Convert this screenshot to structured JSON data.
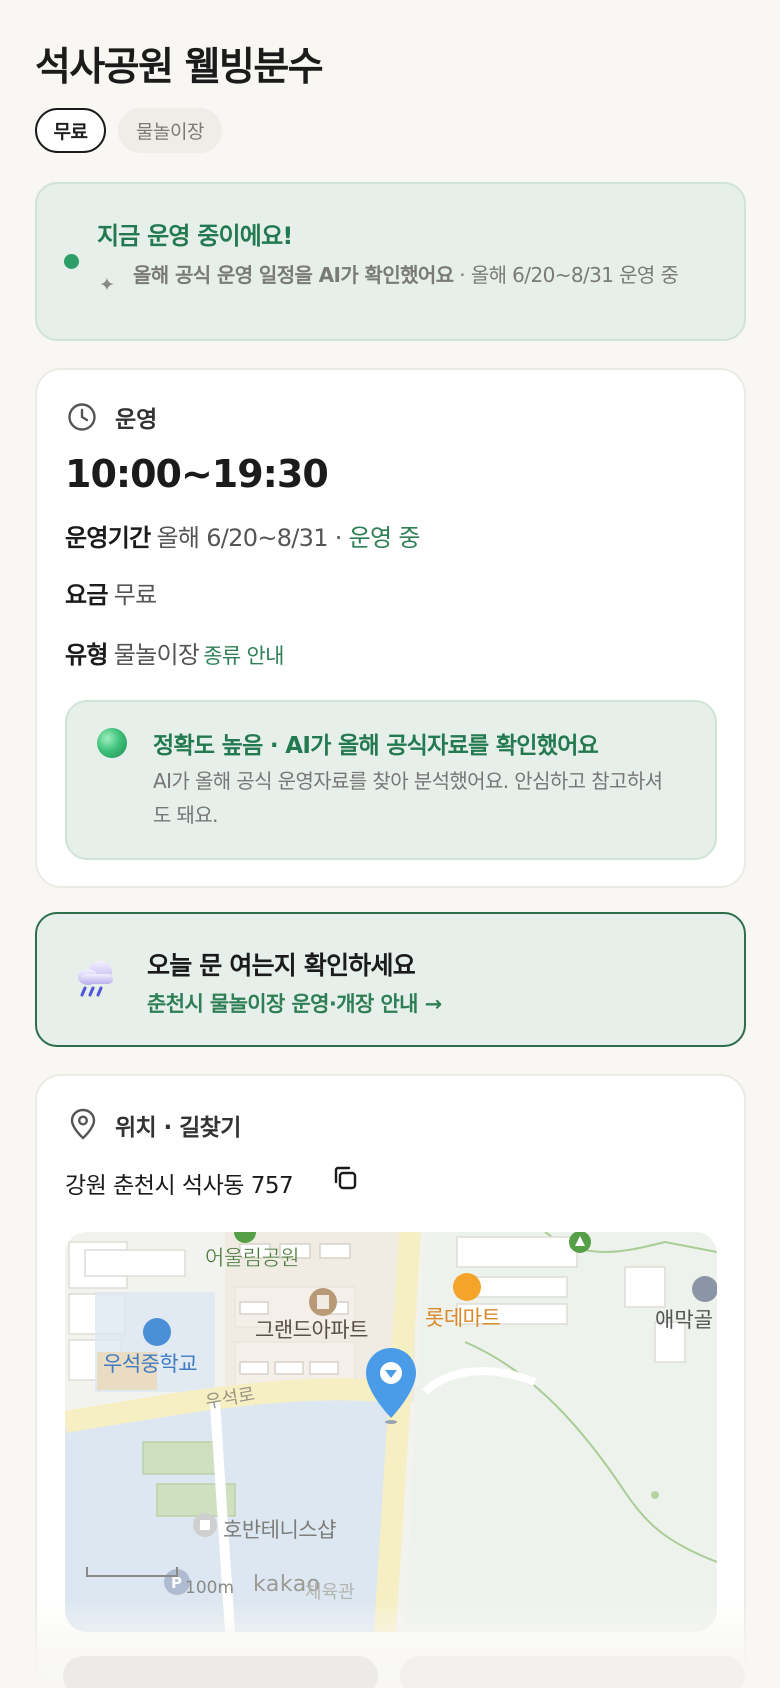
{
  "header": {
    "title": "석사공원 웰빙분수"
  },
  "chips": {
    "fee": "무료",
    "type": "물놀이장"
  },
  "status": {
    "title": "지금 운영 중이에요!",
    "sub_bold": "올해 공식 운영 일정을 AI가 확인했어요",
    "sub_rest": " · 올해 6/20~8/31 운영 중"
  },
  "operation": {
    "label": "운영",
    "hours": "10:00~19:30",
    "period_label": "운영기간",
    "period_value": "올해 6/20~8/31 ·",
    "period_status": "운영 중",
    "fee_label": "요금",
    "fee_value": "무료",
    "type_label": "유형",
    "type_value": "물놀이장",
    "type_link": "종류 안내"
  },
  "accuracy": {
    "title": "정확도 높음 · AI가 올해 공식자료를 확인했어요",
    "body": "AI가 올해 공식 운영자료를 찾아 분석했어요. 안심하고 참고하셔도 돼요."
  },
  "notice": {
    "title": "오늘 문 여는지 확인하세요",
    "link": "춘천시 물놀이장 운영·개장 안내 →"
  },
  "location": {
    "label": "위치 · 길찾기",
    "address": "강원 춘천시 석사동 757",
    "map_labels": {
      "park": "어울림공원",
      "apartment": "그랜드아파트",
      "mart": "롯데마트",
      "school": "우석중학교",
      "road": "우석로",
      "tennis": "호반테니스샵",
      "right_edge": "애막골",
      "scale": "100m",
      "brand": "kakao",
      "gym": "체육관"
    }
  },
  "colors": {
    "accent_green": "#2f7f56",
    "status_bg": "#e6efea",
    "pin_blue": "#4a9be8"
  }
}
